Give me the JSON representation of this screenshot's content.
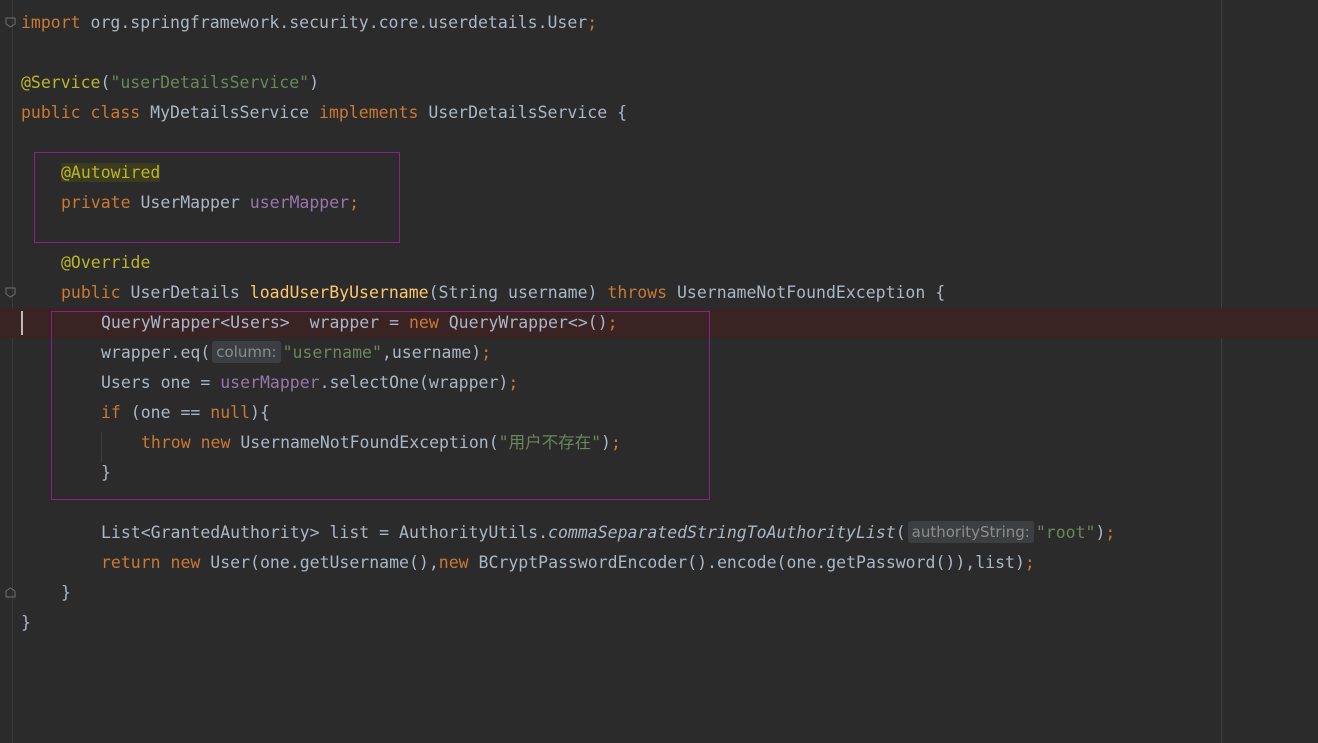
{
  "editor": {
    "lines": {
      "import_kw": "import",
      "import_path": " org.springframework.security.core.userdetails.User",
      "semicolon": ";",
      "service_annotation": "@Service",
      "service_open": "(",
      "service_value": "\"userDetailsService\"",
      "service_close": ")",
      "public": "public",
      "class": "class",
      "class_name": "MyDetailsService",
      "implements": "implements",
      "interface_name": "UserDetailsService",
      "open_brace": "{",
      "autowired": "@Autowired",
      "private": "private",
      "mapper_type": "UserMapper",
      "mapper_field": "userMapper",
      "override": "@Override",
      "return_type": "UserDetails",
      "method_name": "loadUserByUsername",
      "params": "(String username)",
      "throws": "throws",
      "exception_name": "UsernameNotFoundException",
      "qw_type": "QueryWrapper<Users>",
      "qw_var": "  wrapper = ",
      "new": "new",
      "qw_ctor": " QueryWrapper<>()",
      "eq_call": "wrapper.eq(",
      "hint_column": "column:",
      "eq_string": "\"username\"",
      "eq_rest": ",username)",
      "users_decl": "Users one = ",
      "select_call": ".selectOne(wrapper)",
      "if_kw": "if",
      "if_cond": " (one == ",
      "null_kw": "null",
      "if_close": "){",
      "throw_kw": "throw",
      "throw_ex": " UsernameNotFoundException(",
      "throw_msg": "\"用户不存在\"",
      "close_paren": ")",
      "close_brace": "}",
      "list_decl": "List<GrantedAuthority> list = AuthorityUtils.",
      "static_method": "commaSeparatedStringToAuthorityList",
      "hint_authority": "authorityString:",
      "root_string": "\"root\"",
      "return_kw": "return",
      "user_ctor": " User(one.getUsername(),",
      "encoder": " BCryptPasswordEncoder().encode(one.getPassword()),list)"
    }
  },
  "colors": {
    "background": "#2b2b2b",
    "keyword": "#cc7832",
    "annotation": "#bbb529",
    "string": "#6a8759",
    "field": "#9876aa",
    "method_decl": "#ffc66d",
    "plain": "#a9b7c6",
    "highlight_box": "#8b1f8b"
  }
}
